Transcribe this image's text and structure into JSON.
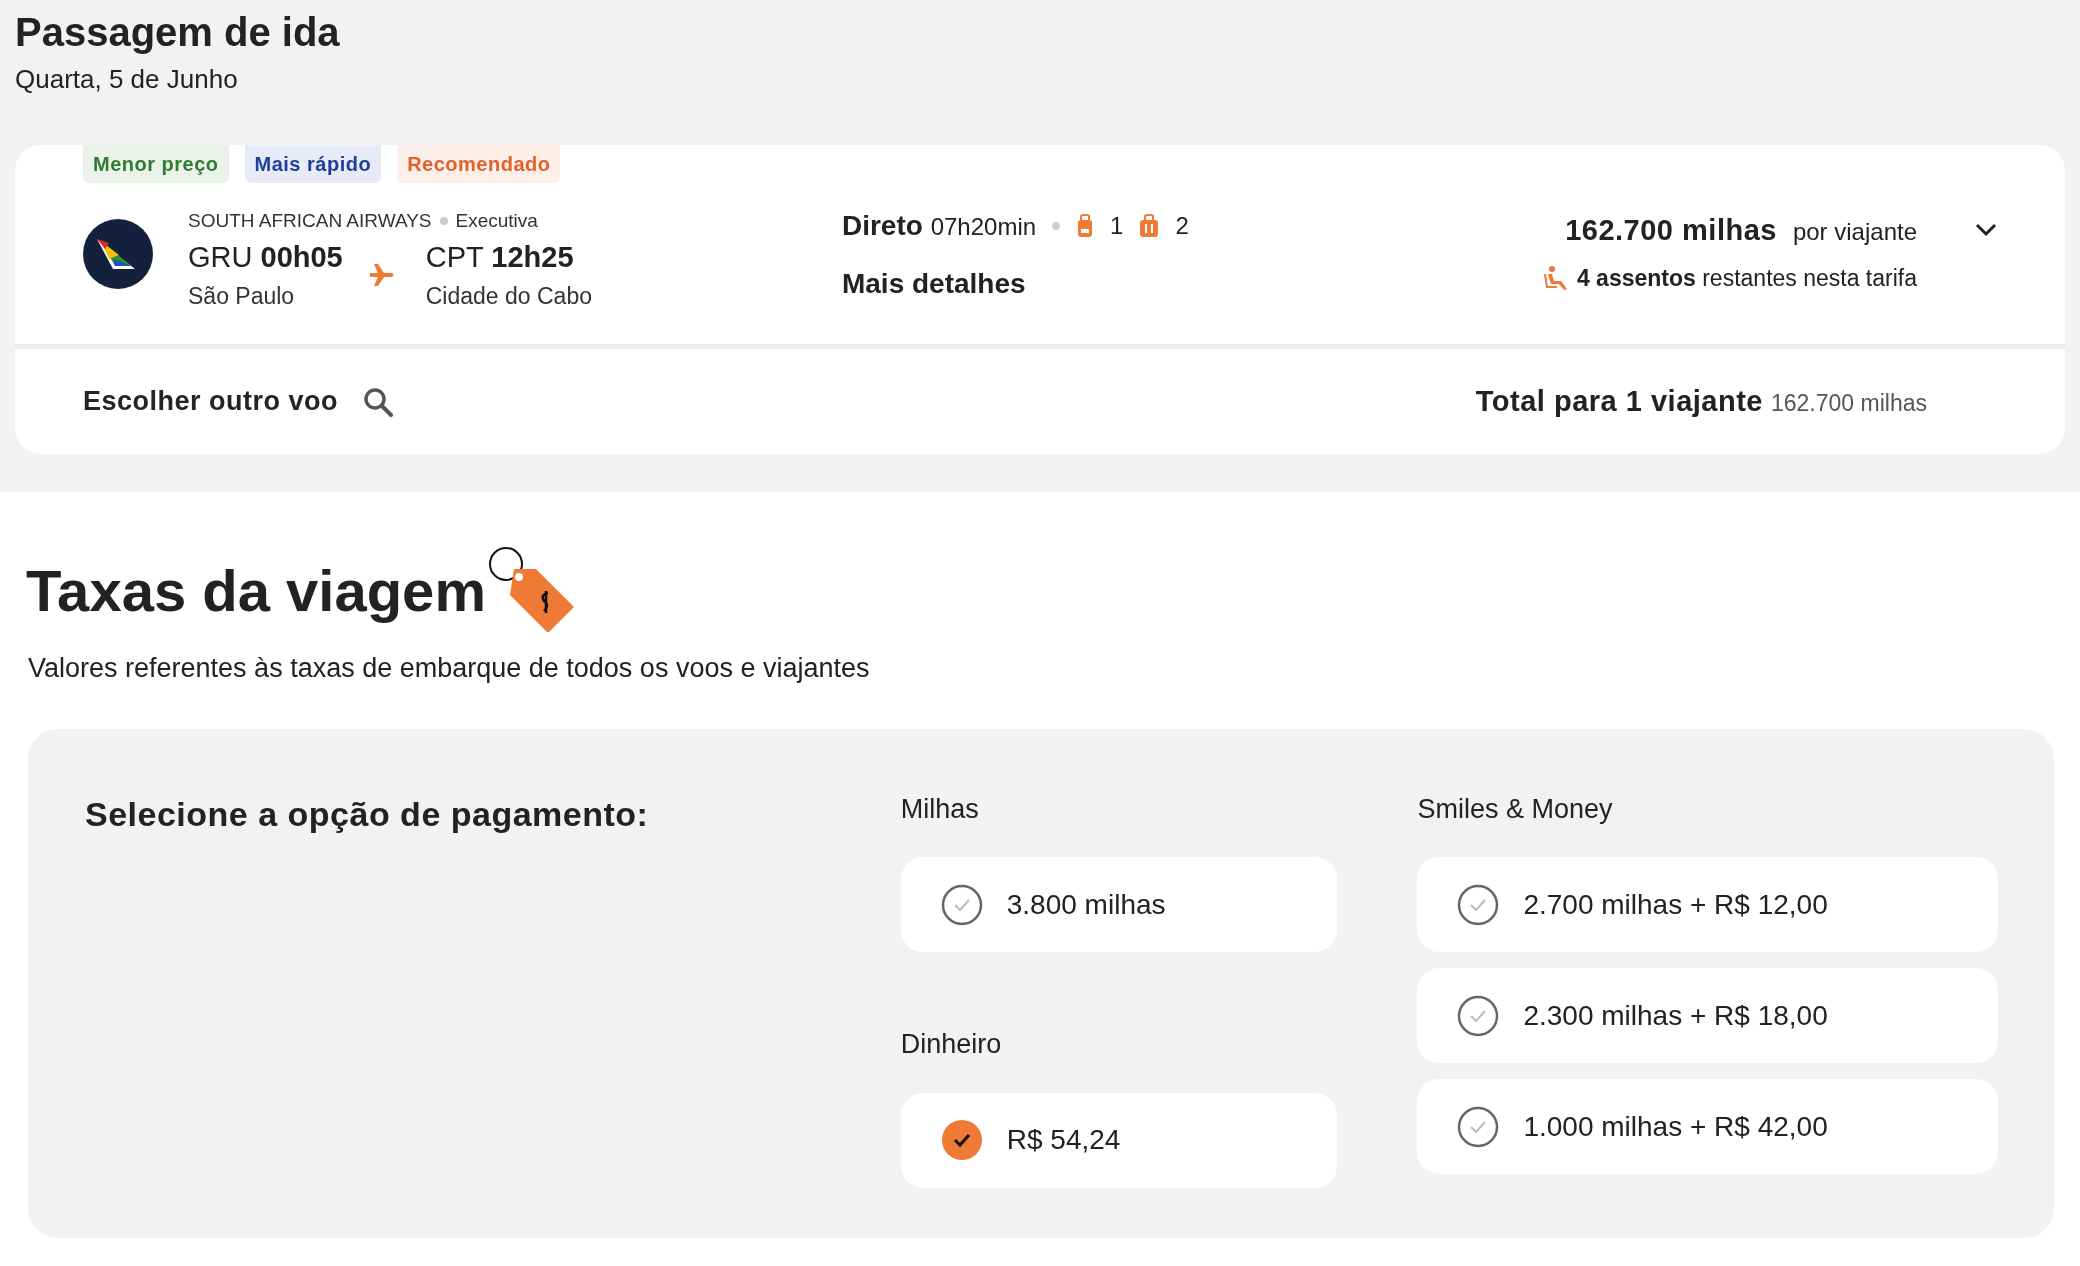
{
  "header": {
    "title": "Passagem de ida",
    "date": "Quarta, 5 de Junho"
  },
  "flight": {
    "badges": [
      {
        "label": "Menor preço",
        "color": "#2e7d32"
      },
      {
        "label": "Mais rápido",
        "color": "#1f3f99"
      },
      {
        "label": "Recomendado",
        "color": "#e0622a"
      }
    ],
    "airline": "SOUTH AFRICAN AIRWAYS",
    "cabin": "Executiva",
    "origin": {
      "code": "GRU",
      "time": "00h05",
      "city": "São Paulo"
    },
    "destination": {
      "code": "CPT",
      "time": "12h25",
      "city": "Cidade do Cabo"
    },
    "stops": "Direto",
    "duration": "07h20min",
    "carry_on": "1",
    "checked_bags": "2",
    "details_link": "Mais detalhes",
    "price": "162.700 milhas",
    "price_unit": "por viajante",
    "seats": "**4 assentos** restantes nesta tarifa",
    "other_flight": "Escolher outro voo",
    "total_label": "Total para 1 viajante",
    "total_value": "162.700 milhas"
  },
  "fees": {
    "title": "Taxas da viagem",
    "subtitle": "Valores referentes às taxas de embarque de todos os voos e viajantes",
    "prompt": "Selecione a opção de pagamento:",
    "groups": [
      {
        "label": "Milhas",
        "options": [
          {
            "label": "3.800 milhas",
            "selected": false
          }
        ]
      },
      {
        "label": "Dinheiro",
        "options": [
          {
            "label": "R$ 54,24",
            "selected": true
          }
        ]
      },
      {
        "label": "Smiles & Money",
        "options": [
          {
            "label": "2.700 milhas + R$ 12,00",
            "selected": false
          },
          {
            "label": "2.300 milhas + R$ 18,00",
            "selected": false
          },
          {
            "label": "1.000 milhas + R$ 42,00",
            "selected": false
          }
        ]
      }
    ]
  }
}
